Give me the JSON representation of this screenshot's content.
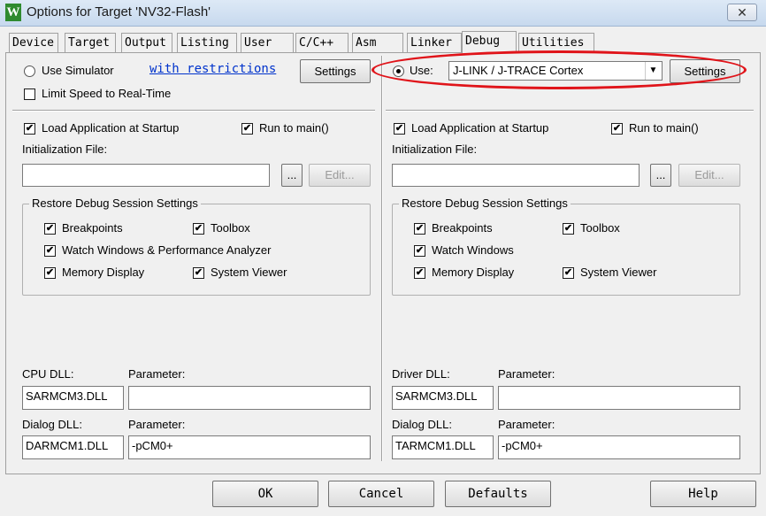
{
  "window": {
    "title": "Options for Target 'NV32-Flash'",
    "icon_letter": "W",
    "close_label": "✕"
  },
  "tabs": [
    {
      "label": "Device"
    },
    {
      "label": "Target"
    },
    {
      "label": "Output"
    },
    {
      "label": "Listing"
    },
    {
      "label": "User"
    },
    {
      "label": "C/C++"
    },
    {
      "label": "Asm"
    },
    {
      "label": "Linker"
    },
    {
      "label": "Debug",
      "active": true
    },
    {
      "label": "Utilities"
    }
  ],
  "left": {
    "use_simulator_label": "Use Simulator",
    "restrictions_link": "with restrictions",
    "settings_label": "Settings",
    "limit_speed_label": "Limit Speed to Real-Time",
    "load_app_label": "Load Application at Startup",
    "run_to_main_label": "Run to main()",
    "init_file_label": "Initialization File:",
    "init_file_value": "",
    "browse_label": "...",
    "edit_label": "Edit...",
    "restore_group_label": "Restore Debug Session Settings",
    "breakpoints_label": "Breakpoints",
    "toolbox_label": "Toolbox",
    "watch_label": "Watch Windows & Performance Analyzer",
    "memory_label": "Memory Display",
    "system_viewer_label": "System Viewer",
    "cpu_dll_label": "CPU DLL:",
    "cpu_param_label": "Parameter:",
    "cpu_dll_value": "SARMCM3.DLL",
    "cpu_param_value": "",
    "dialog_dll_label": "Dialog DLL:",
    "dialog_param_label": "Parameter:",
    "dialog_dll_value": "DARMCM1.DLL",
    "dialog_param_value": "-pCM0+"
  },
  "right": {
    "use_label": "Use:",
    "debugger_value": "J-LINK / J-TRACE Cortex",
    "settings_label": "Settings",
    "load_app_label": "Load Application at Startup",
    "run_to_main_label": "Run to main()",
    "init_file_label": "Initialization File:",
    "init_file_value": "",
    "browse_label": "...",
    "edit_label": "Edit...",
    "restore_group_label": "Restore Debug Session Settings",
    "breakpoints_label": "Breakpoints",
    "toolbox_label": "Toolbox",
    "watch_label": "Watch Windows",
    "memory_label": "Memory Display",
    "system_viewer_label": "System Viewer",
    "driver_dll_label": "Driver DLL:",
    "driver_param_label": "Parameter:",
    "driver_dll_value": "SARMCM3.DLL",
    "driver_param_value": "",
    "dialog_dll_label": "Dialog DLL:",
    "dialog_param_label": "Parameter:",
    "dialog_dll_value": "TARMCM1.DLL",
    "dialog_param_value": "-pCM0+"
  },
  "footer": {
    "ok_label": "OK",
    "cancel_label": "Cancel",
    "defaults_label": "Defaults",
    "help_label": "Help"
  },
  "check_mark": "✔",
  "dropdown_arrow": "▼",
  "colors": {
    "highlight_oval": "#e0141a",
    "link": "#0033cc"
  }
}
